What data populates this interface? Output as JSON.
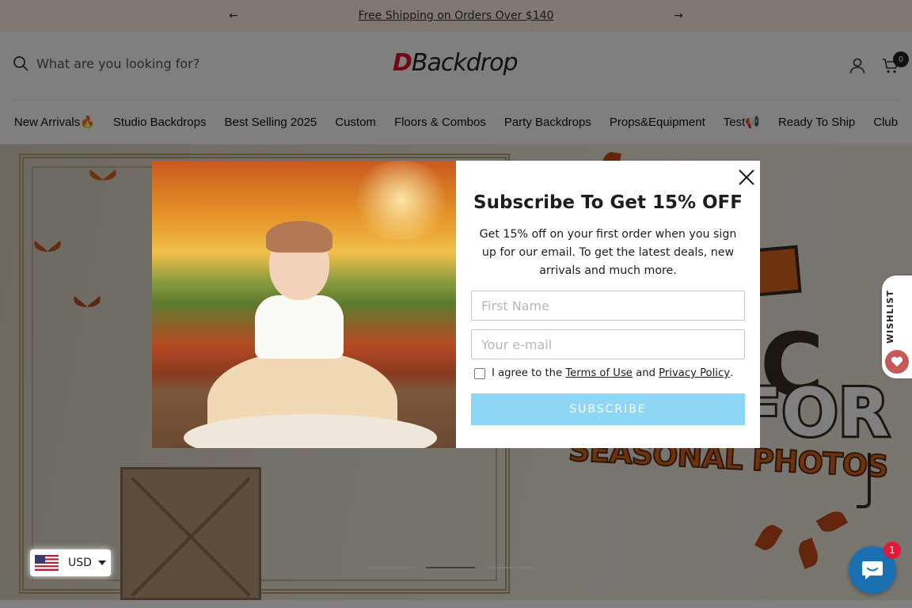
{
  "announcement": {
    "text": "Free Shipping on Orders Over $140",
    "prev_icon": "arrow-left-icon",
    "next_icon": "arrow-right-icon"
  },
  "header": {
    "search_placeholder": "What are you looking for?",
    "logo_d": "D",
    "logo_rest": "Backdrop",
    "cart_count": "0"
  },
  "nav": {
    "items": [
      "New Arrivals🔥",
      "Studio Backdrops",
      "Best Selling 2025",
      "Custom",
      "Floors & Combos",
      "Party Backdrops",
      "Props&Equipment",
      "Test📢",
      "Ready To Ship",
      "Club"
    ]
  },
  "hero": {
    "word_c": "C",
    "word_for": "FOR",
    "seasonal": "SEASONAL PHOTOS"
  },
  "modal": {
    "title": "Subscribe To Get 15% OFF",
    "description": "Get 15% off on your first order when you sign up for our email. To get the latest deals, new arrivals and much more.",
    "first_name_placeholder": "First Name",
    "email_placeholder": "Your e-mail",
    "agree_prefix": "I agree to the ",
    "terms_link": "Terms of Use",
    "agree_and": " and ",
    "privacy_link": "Privacy Policy",
    "agree_suffix": ".",
    "submit_label": "SUBSCRIBE"
  },
  "wishlist": {
    "label": "WISHLIST"
  },
  "currency": {
    "code": "USD"
  },
  "chat": {
    "badge_count": "1"
  },
  "colors": {
    "announcement_bg": "#fff3e4",
    "submit_bg": "#8dd6f5",
    "logo_accent": "#e0132b",
    "chat_bg": "#1a6fb0",
    "badge_bg": "#e0193a"
  }
}
